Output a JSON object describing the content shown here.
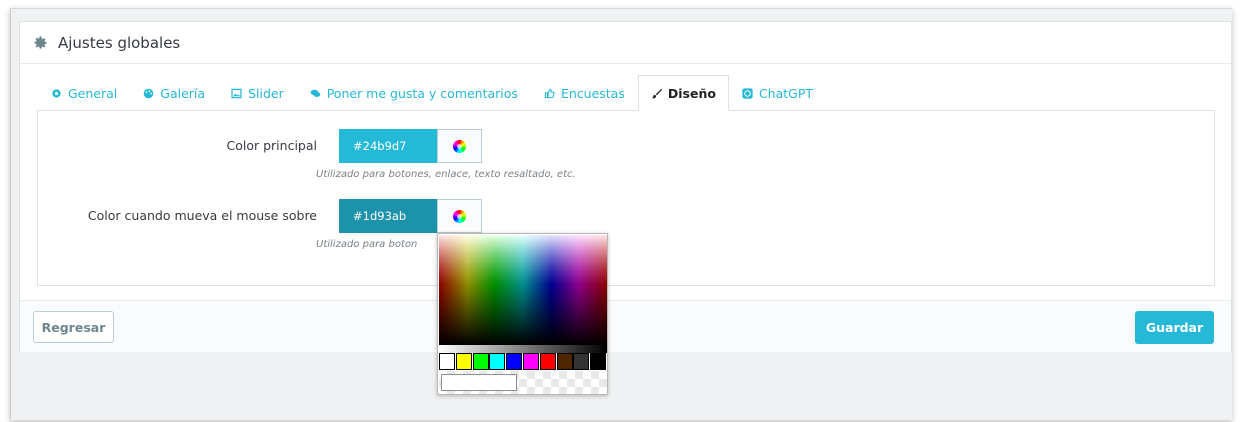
{
  "panel": {
    "title": "Ajustes globales"
  },
  "tabs": [
    {
      "label": "General",
      "icon": "gear-icon"
    },
    {
      "label": "Galería",
      "icon": "palette-icon"
    },
    {
      "label": "Slider",
      "icon": "image-icon"
    },
    {
      "label": "Poner me gusta y comentarios",
      "icon": "comments-icon"
    },
    {
      "label": "Encuestas",
      "icon": "thumbs-up-icon"
    },
    {
      "label": "Diseño",
      "icon": "brush-icon",
      "active": true
    },
    {
      "label": "ChatGPT",
      "icon": "chatgpt-icon"
    }
  ],
  "fields": {
    "primary": {
      "label": "Color principal",
      "value": "#24b9d7",
      "help": "Utilizado para botones, enlace, texto resaltado, etc."
    },
    "hover": {
      "label": "Color cuando mueva el mouse sobre",
      "value": "#1d93ab",
      "help": "Utilizado para boton"
    }
  },
  "footer": {
    "back_label": "Regresar",
    "save_label": "Guardar"
  },
  "colors": {
    "accent": "#25b9d7",
    "primary_swatch": "#24b9d7",
    "hover_swatch": "#1d93ab"
  },
  "picker": {
    "swatches": [
      "#ffffff",
      "#ffff00",
      "#00ff00",
      "#00ffff",
      "#0000ff",
      "#ff00ff",
      "#ff0000",
      "#4d2600",
      "#333333",
      "#000000"
    ]
  }
}
